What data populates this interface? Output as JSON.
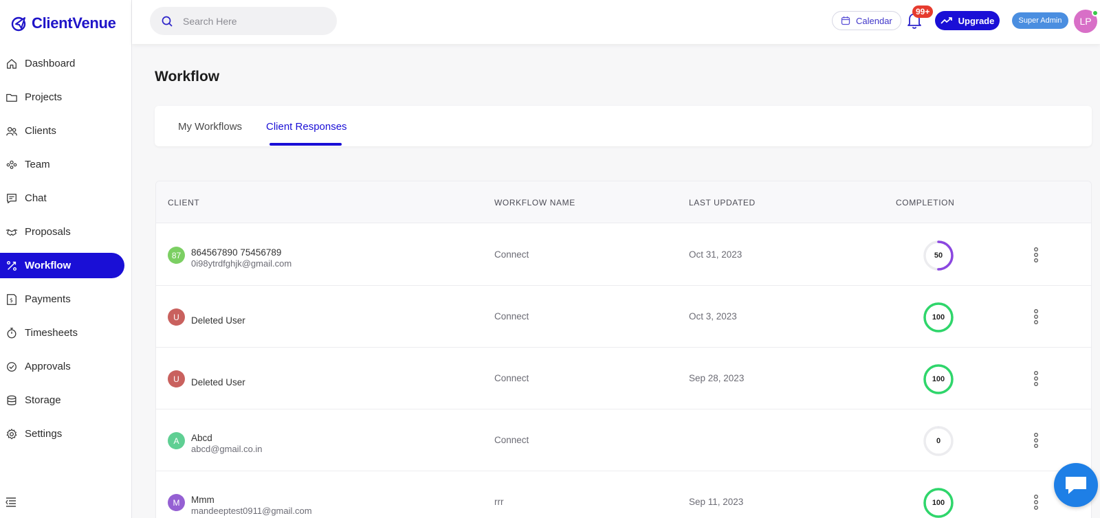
{
  "app": {
    "brand": "ClientVenue"
  },
  "sidebar": {
    "items": [
      {
        "label": "Dashboard",
        "icon": "home-icon"
      },
      {
        "label": "Projects",
        "icon": "folder-icon"
      },
      {
        "label": "Clients",
        "icon": "users-icon"
      },
      {
        "label": "Team",
        "icon": "team-icon"
      },
      {
        "label": "Chat",
        "icon": "chat-icon"
      },
      {
        "label": "Proposals",
        "icon": "handshake-icon"
      },
      {
        "label": "Workflow",
        "icon": "workflow-icon",
        "active": true
      },
      {
        "label": "Payments",
        "icon": "payments-icon"
      },
      {
        "label": "Timesheets",
        "icon": "stopwatch-icon"
      },
      {
        "label": "Approvals",
        "icon": "check-circle-icon"
      },
      {
        "label": "Storage",
        "icon": "database-icon"
      },
      {
        "label": "Settings",
        "icon": "gear-icon"
      }
    ]
  },
  "header": {
    "search_placeholder": "Search Here",
    "calendar_label": "Calendar",
    "notification_count": "99+",
    "upgrade_label": "Upgrade",
    "role_label": "Super Admin",
    "user_initials": "LP"
  },
  "page": {
    "title": "Workflow",
    "tabs": [
      {
        "label": "My Workflows",
        "active": false
      },
      {
        "label": "Client Responses",
        "active": true
      }
    ]
  },
  "table": {
    "columns": [
      "CLIENT",
      "WORKFLOW NAME",
      "LAST UPDATED",
      "COMPLETION"
    ],
    "rows": [
      {
        "initials": "87",
        "avatar_color": "#7ccf63",
        "name": "864567890 75456789",
        "email": "0i98ytrdfghjk@gmail.com",
        "workflow": "Connect",
        "updated": "Oct 31, 2023",
        "completion": "50",
        "ring_color": "#8b47e0"
      },
      {
        "initials": "U",
        "avatar_color": "#c9615e",
        "name": "Deleted User",
        "email": "",
        "workflow": "Connect",
        "updated": "Oct 3, 2023",
        "completion": "100",
        "ring_color": "#2fd66b"
      },
      {
        "initials": "U",
        "avatar_color": "#c9615e",
        "name": "Deleted User",
        "email": "",
        "workflow": "Connect",
        "updated": "Sep 28, 2023",
        "completion": "100",
        "ring_color": "#2fd66b"
      },
      {
        "initials": "A",
        "avatar_color": "#5fcf93",
        "name": "Abcd",
        "email": "abcd@gmail.co.in",
        "workflow": "Connect",
        "updated": "",
        "completion": "0",
        "ring_color": "#e9e9ee"
      },
      {
        "initials": "M",
        "avatar_color": "#9560d3",
        "name": "Mmm",
        "email": "mandeeptest0911@gmail.com",
        "workflow": "rrr",
        "updated": "Sep 11, 2023",
        "completion": "100",
        "ring_color": "#2fd66b"
      }
    ]
  }
}
